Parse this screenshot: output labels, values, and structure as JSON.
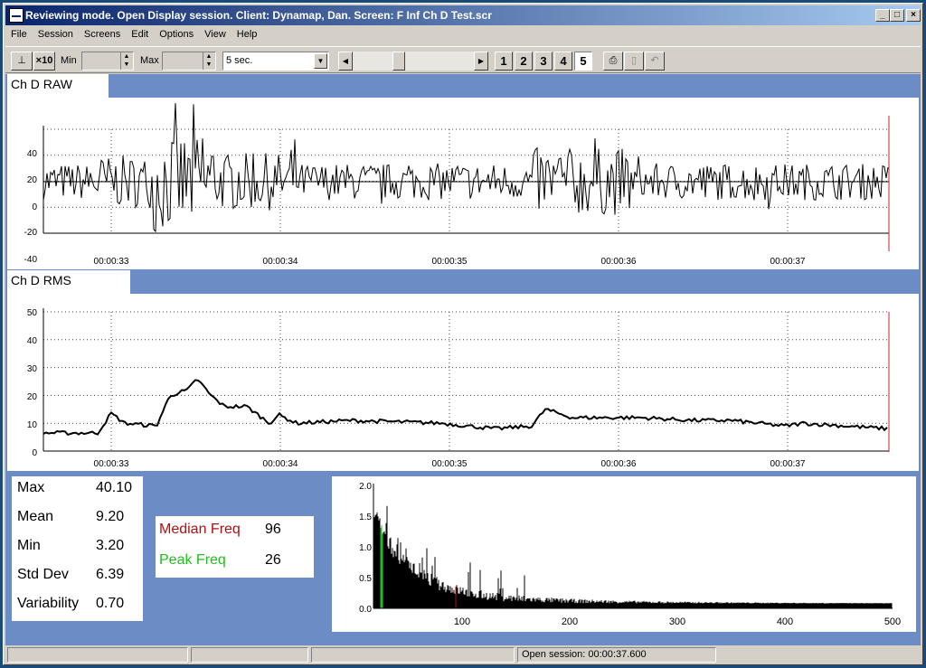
{
  "window": {
    "title": "Reviewing mode. Open Display session. Client: Dynamap, Dan. Screen: F Inf Ch D Test.scr"
  },
  "menu": [
    "File",
    "Session",
    "Screens",
    "Edit",
    "Options",
    "View",
    "Help"
  ],
  "toolbar": {
    "x10_label": "×10",
    "min_label": "Min",
    "max_label": "Max",
    "min_value": "",
    "max_value": "",
    "timespan_value": "5 sec.",
    "screen_buttons": [
      "1",
      "2",
      "3",
      "4",
      "5"
    ],
    "active_screen": "5"
  },
  "channels": {
    "raw": {
      "label": "Ch D RAW",
      "y_ticks": [
        "40",
        "20",
        "0",
        "-20",
        "-40"
      ],
      "x_ticks": [
        "00:00:33",
        "00:00:34",
        "00:00:35",
        "00:00:36",
        "00:00:37"
      ]
    },
    "rms": {
      "label": "Ch D RMS",
      "y_ticks": [
        "50",
        "40",
        "30",
        "20",
        "10",
        "0"
      ],
      "x_ticks": [
        "00:00:33",
        "00:00:34",
        "00:00:35",
        "00:00:36",
        "00:00:37"
      ]
    }
  },
  "stats": [
    {
      "label": "Max",
      "value": "40.10"
    },
    {
      "label": "Mean",
      "value": "9.20"
    },
    {
      "label": "Min",
      "value": "3.20"
    },
    {
      "label": "Std Dev",
      "value": "6.39"
    },
    {
      "label": "Variability",
      "value": "0.70"
    }
  ],
  "freq": {
    "median_label": "Median Freq",
    "median_value": "96",
    "peak_label": "Peak Freq",
    "peak_value": "26",
    "median_color": "#b01010",
    "peak_color": "#20c020"
  },
  "spectrum": {
    "y_ticks": [
      "2.0",
      "1.5",
      "1.0",
      "0.5",
      "0.0"
    ],
    "x_ticks": [
      "100",
      "200",
      "300",
      "400",
      "500"
    ]
  },
  "status": {
    "session_text": "Open session: 00:00:37.600"
  },
  "colors": {
    "panel_blue": "#6b8cc4",
    "marker_red": "#cc2020"
  }
}
